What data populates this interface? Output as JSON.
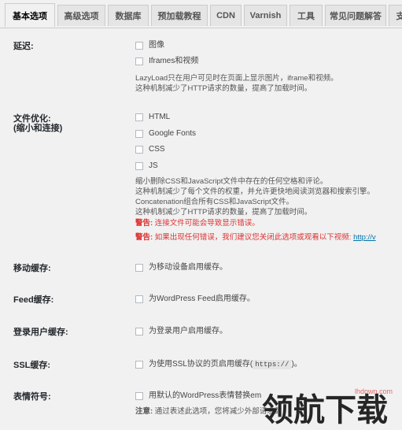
{
  "tabs": [
    {
      "label": "基本选项"
    },
    {
      "label": "高级选项"
    },
    {
      "label": "数据库"
    },
    {
      "label": "预加载教程"
    },
    {
      "label": "CDN"
    },
    {
      "label": "Varnish"
    },
    {
      "label": "工具"
    },
    {
      "label": "常见问题解答"
    },
    {
      "label": "支"
    }
  ],
  "lazyload": {
    "label": "延迟:",
    "options": [
      "图像",
      "Iframes和视频"
    ],
    "desc": [
      "LazyLoad只在用户可见时在页面上显示图片，iframe和视频。",
      "这种机制减少了HTTP请求的数量，提高了加载时间。"
    ]
  },
  "file_opt": {
    "label": "文件优化:",
    "sublabel": "(缩小和连接)",
    "options": [
      "HTML",
      "Google Fonts",
      "CSS",
      "JS"
    ],
    "desc": [
      "缩小删除CSS和JavaScript文件中存在的任何空格和评论。",
      "这种机制减少了每个文件的权重，并允许更快地阅读浏览器和搜索引擎。",
      "Concatenation组合所有CSS和JavaScript文件。",
      "这种机制减少了HTTP请求的数量，提高了加载时间。"
    ],
    "warn1_label": "警告:",
    "warn1_text": " 连接文件可能会导致显示错误。",
    "warn2_label": "警告:",
    "warn2_text": " 如果出现任何错误，我们建议您关闭此选项或观看以下视频:",
    "warn2_link": "http://v"
  },
  "mobile_cache": {
    "label": "移动缓存:",
    "option": "为移动设备启用缓存。"
  },
  "feed_cache": {
    "label": "Feed缓存:",
    "option": "为WordPress Feed启用缓存。"
  },
  "login_cache": {
    "label": "登录用户缓存:",
    "option": "为登录用户启用缓存。"
  },
  "ssl_cache": {
    "label": "SSL缓存:",
    "option_prefix": "为使用SSL协议的页启用缓存(",
    "option_code": "https://",
    "option_suffix": ")。"
  },
  "emoji": {
    "label": "表情符号:",
    "option": "用默认的WordPress表情替换em",
    "note_label": "注意:",
    "note_text": " 通过表述此选项，您将减少外部请求数"
  },
  "watermark": {
    "text": "领航下载",
    "url": "lhdown.com"
  },
  "colors": {
    "warning": "#dc3232",
    "link": "#0073aa",
    "background": "#f1f1f1"
  }
}
